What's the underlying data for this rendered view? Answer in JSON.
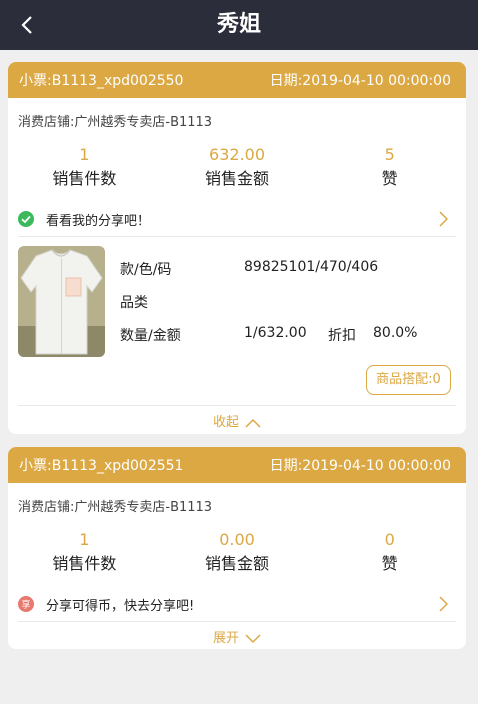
{
  "header": {
    "title": "秀姐",
    "back_icon": "chevron-left-icon"
  },
  "orders": [
    {
      "receipt": "小票:B1113_xpd002550",
      "date": "日期:2019-04-10 00:00:00",
      "store": "消费店铺:广州越秀专卖店-B1113",
      "stats": [
        {
          "value": "1",
          "label": "销售件数"
        },
        {
          "value": "632.00",
          "label": "销售金额"
        },
        {
          "value": "5",
          "label": "赞"
        }
      ],
      "share_text": "看看我的分享吧！",
      "share_icon": "check-circle-icon",
      "product": {
        "style_label": "款/色/码",
        "style_value": "89825101/470/406",
        "category_label": "品类",
        "qty_label": "数量/金额",
        "qty_value": "1/632.00",
        "discount_label": "折扣",
        "discount_value": "80.0%",
        "match_button": "商品搭配:0"
      },
      "toggle_label": "收起"
    },
    {
      "receipt": "小票:B1113_xpd002551",
      "date": "日期:2019-04-10 00:00:00",
      "store": "消费店铺:广州越秀专卖店-B1113",
      "stats": [
        {
          "value": "1",
          "label": "销售件数"
        },
        {
          "value": "0.00",
          "label": "销售金额"
        },
        {
          "value": "0",
          "label": "赞"
        }
      ],
      "share_text": "分享可得币，快去分享吧!",
      "share_badge": "享",
      "share_icon": "share-coin-icon",
      "toggle_label": "展开"
    }
  ],
  "colors": {
    "accent": "#dba844",
    "header_bg": "#2b2d3b",
    "check_green": "#3cb95d",
    "badge_red": "#e8796f"
  }
}
